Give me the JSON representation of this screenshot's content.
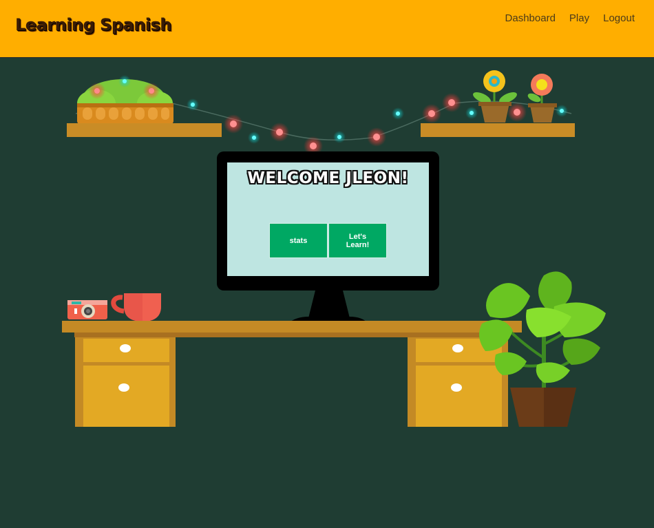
{
  "navbar": {
    "brand": "Learning Spanish",
    "links": [
      "Dashboard",
      "Play",
      "Logout"
    ]
  },
  "screen": {
    "welcome": "WELCOME JLEON!",
    "buttons": {
      "stats": "stats",
      "learn": "Let's Learn!"
    }
  },
  "colors": {
    "navbar": "#ffae00",
    "background": "#1f3d33",
    "screen": "#bee5e1",
    "button": "#00a863",
    "wood": "#c48a25",
    "drawer": "#e3a924"
  },
  "icons": [
    "string-lights",
    "bush-basket-icon",
    "sunflower-icon",
    "pink-flower-icon",
    "camera-icon",
    "mug-icon",
    "potted-plant-icon"
  ]
}
